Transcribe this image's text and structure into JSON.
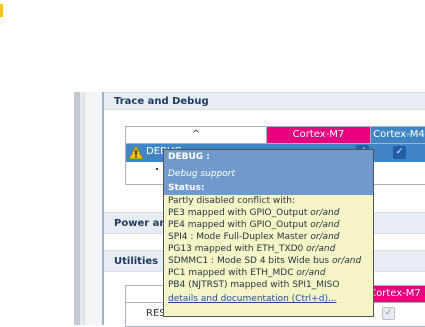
{
  "sections": {
    "trace_title": "Trace and Debug",
    "power_title": "Power and Thermal",
    "utilities_title": "Utilities"
  },
  "table": {
    "sort_indicator": "^",
    "col_m7": "Cortex-M7",
    "col_m4": "Cortex-M4",
    "row_label": "DEBUG"
  },
  "table2": {
    "col_m7": "Cortex-M7",
    "row_label": "RESET"
  },
  "tooltip": {
    "title": "DEBUG :",
    "subtitle": "Debug support",
    "status_label": "Status:",
    "lines": [
      {
        "text": "Partly disabled conflict with:",
        "suffix": ""
      },
      {
        "text": "PE3 mapped with GPIO_Output ",
        "suffix": "or/and"
      },
      {
        "text": "PE4 mapped with GPIO_Output ",
        "suffix": "or/and"
      },
      {
        "text": "SPI4 : Mode Full-Duplex Master ",
        "suffix": "or/and"
      },
      {
        "text": "PG13 mapped with ETH_TXD0 ",
        "suffix": "or/and"
      },
      {
        "text": "SDMMC1 : Mode SD 4 bits Wide bus ",
        "suffix": "or/and"
      },
      {
        "text": "PC1 mapped with ETH_MDC ",
        "suffix": "or/and"
      },
      {
        "text": "PB4 (NJTRST) mapped with SPI1_MISO",
        "suffix": ""
      }
    ],
    "link": "details and documentation (Ctrl+d)..."
  }
}
